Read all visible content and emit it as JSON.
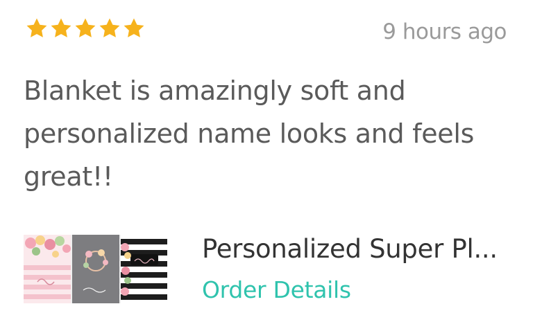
{
  "review": {
    "rating": 5,
    "rating_max": 5,
    "star_color": "#f6b21c",
    "timestamp": "9 hours ago",
    "text": "Blanket is amazingly soft and personalized name looks and feels great!!"
  },
  "product": {
    "thumbnail_icon": "blanket-collage-image",
    "title": "Personalized Super Pl...",
    "order_link_label": "Order Details",
    "link_color": "#2fc3ad"
  }
}
